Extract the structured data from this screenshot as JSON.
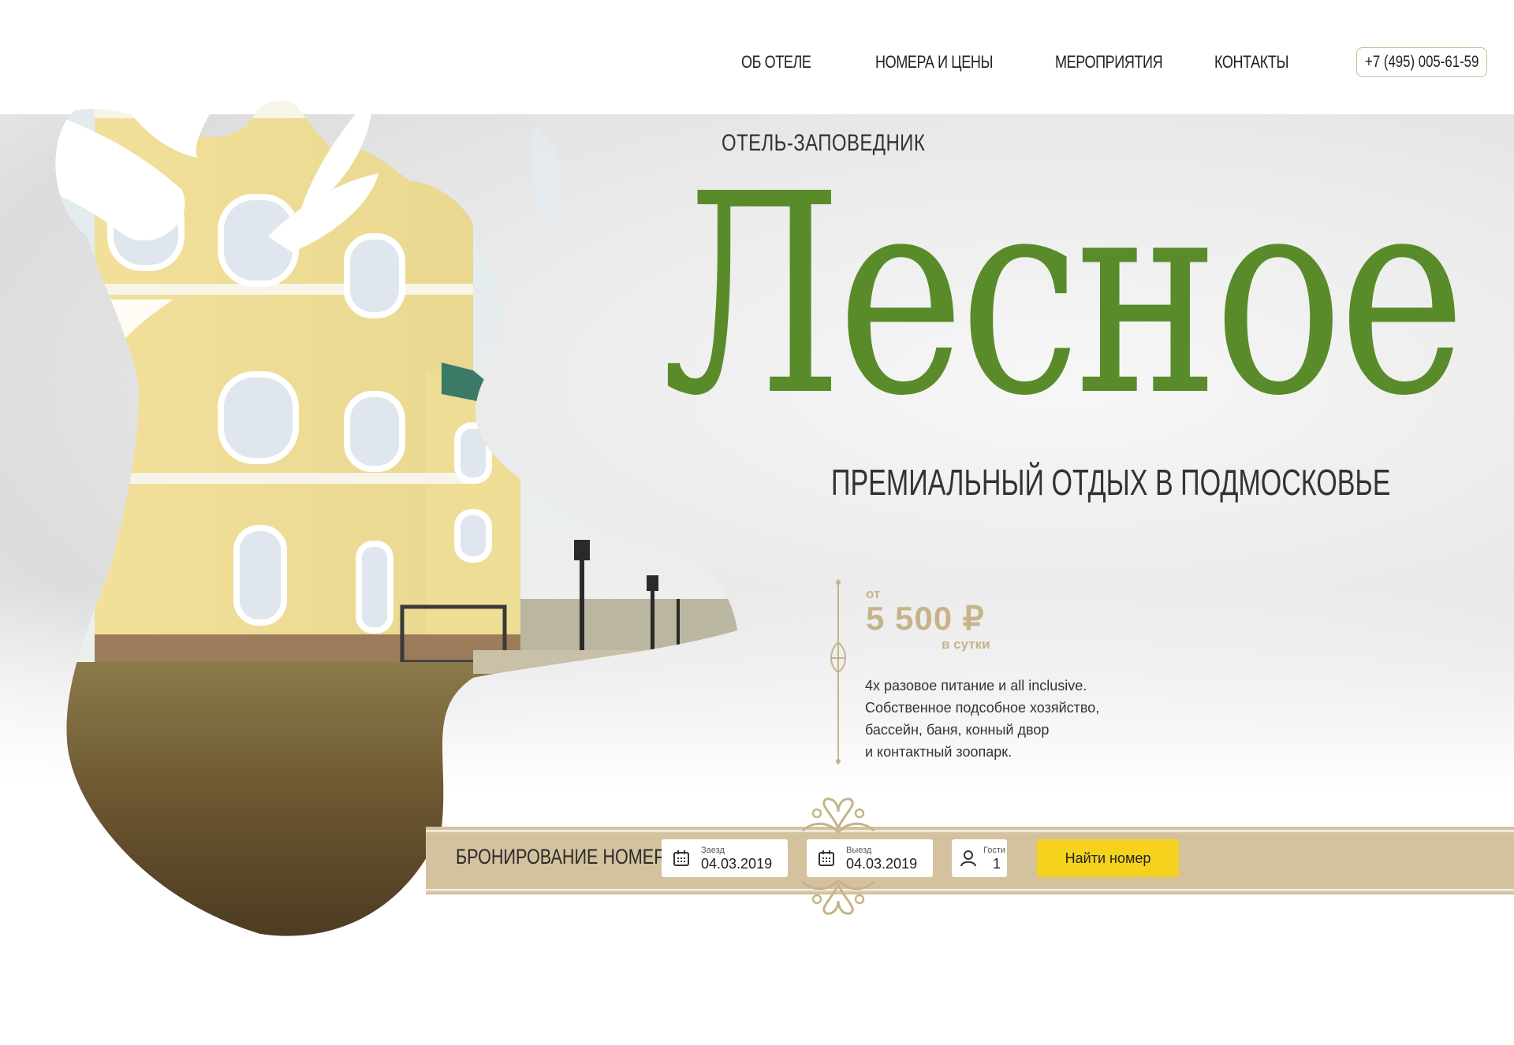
{
  "nav": {
    "items": [
      {
        "label": "ОБ ОТЕЛЕ"
      },
      {
        "label": "НОМЕРА И ЦЕНЫ"
      },
      {
        "label": "МЕРОПРИЯТИЯ"
      },
      {
        "label": "КОНТАКТЫ"
      }
    ],
    "phone": "+7 (495) 005-61-59"
  },
  "hero": {
    "eyebrow": "ОТЕЛЬ-ЗАПОВЕДНИК",
    "title": "Лесное",
    "subtitle": "ПРЕМИАЛЬНЫЙ ОТДЫХ В ПОДМОСКОВЬЕ",
    "price": {
      "from": "от",
      "value": "5 500 ₽",
      "unit": "в сутки"
    },
    "description": [
      "4х разовое питание и all inclusive.",
      "Собственное подсобное хозяйство,",
      "бассейн, баня, конный двор",
      "и контактный зоопарк."
    ]
  },
  "booking": {
    "title": "БРОНИРОВАНИЕ НОМЕРОВ",
    "checkin": {
      "label": "Заезд",
      "value": "04.03.2019"
    },
    "checkout": {
      "label": "Выезд",
      "value": "04.03.2019"
    },
    "guests": {
      "label": "Гости",
      "value": "1"
    },
    "search_label": "Найти номер"
  },
  "colors": {
    "brand_green": "#5a8b2a",
    "gold": "#c7b38a",
    "band": "#d4c19e",
    "button": "#f4d21d"
  },
  "icons": [
    "calendar-icon",
    "calendar-icon",
    "user-icon",
    "ornament-icon",
    "deer-silhouette"
  ]
}
